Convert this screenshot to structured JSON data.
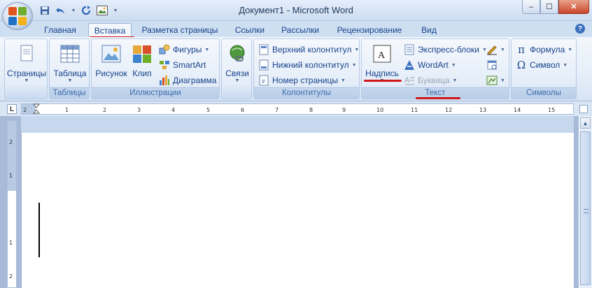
{
  "window": {
    "title": "Документ1 - Microsoft Word",
    "controls": {
      "minimize": "–",
      "maximize": "☐",
      "close": "✕"
    }
  },
  "quick_access": [
    {
      "icon": "save-icon"
    },
    {
      "icon": "undo-icon"
    },
    {
      "icon": "redo-icon"
    },
    {
      "icon": "picture-icon"
    }
  ],
  "tabs": [
    {
      "label": "Главная",
      "active": false
    },
    {
      "label": "Вставка",
      "active": true
    },
    {
      "label": "Разметка страницы",
      "active": false
    },
    {
      "label": "Ссылки",
      "active": false
    },
    {
      "label": "Рассылки",
      "active": false
    },
    {
      "label": "Рецензирование",
      "active": false
    },
    {
      "label": "Вид",
      "active": false
    }
  ],
  "help": "?",
  "ribbon": {
    "pages": {
      "button": "Страницы"
    },
    "tables": {
      "button": "Таблица",
      "label": "Таблицы"
    },
    "illustrations": {
      "picture": "Рисунок",
      "clip": "Клип",
      "shapes": "Фигуры",
      "smartart": "SmartArt",
      "chart": "Диаграмма",
      "label": "Иллюстрации"
    },
    "links": {
      "button": "Связи"
    },
    "header_footer": {
      "header": "Верхний колонтитул",
      "footer": "Нижний колонтитул",
      "page_number": "Номер страницы",
      "label": "Колонтитулы"
    },
    "text": {
      "textbox": "Надпись",
      "quick_parts": "Экспресс-блоки",
      "wordart": "WordArt",
      "dropcap": "Буквица",
      "label": "Текст"
    },
    "symbols": {
      "equation": "Формула",
      "symbol": "Символ",
      "label": "Символы"
    }
  },
  "ruler": {
    "corner": "L",
    "ticks": [
      "2",
      "1",
      "1",
      "2",
      "3",
      "4",
      "5",
      "6",
      "7",
      "8",
      "9",
      "10",
      "11",
      "12",
      "13",
      "14",
      "15"
    ]
  },
  "vertical_ruler": {
    "ticks": [
      "2",
      "1",
      "1",
      "2"
    ]
  },
  "colors": {
    "annotation": "#d0161b",
    "ribbon_text": "#15428b"
  }
}
